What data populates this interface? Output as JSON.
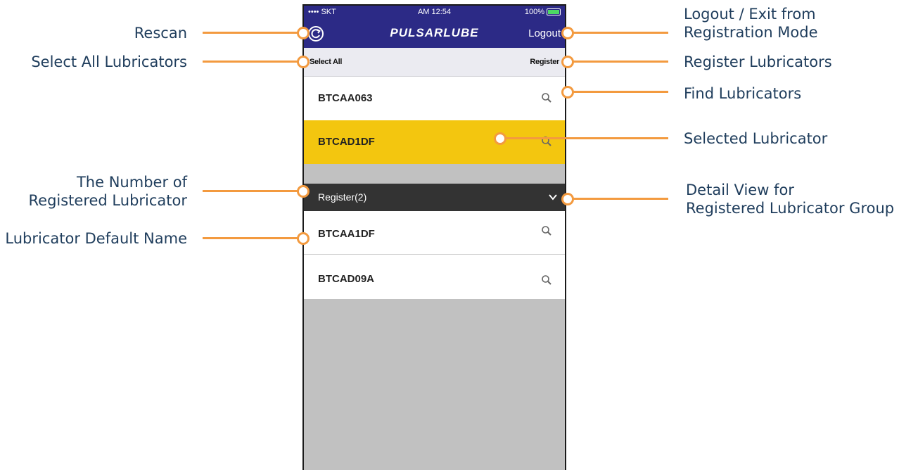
{
  "status_bar": {
    "carrier": "•••• SKT",
    "time": "AM 12:54",
    "battery": "100%"
  },
  "nav": {
    "brand": "PULSARLUBE",
    "logout_label": "Logout"
  },
  "action_bar": {
    "select_all_label": "Select All",
    "register_label": "Register"
  },
  "scanned": [
    {
      "name": "BTCAA063",
      "selected": false
    },
    {
      "name": "BTCAD1DF",
      "selected": true
    }
  ],
  "registered_group": {
    "title": "Register(2)",
    "items": [
      {
        "name": "BTCAA1DF"
      },
      {
        "name": "BTCAD09A"
      }
    ]
  },
  "annotations": {
    "rescan": "Rescan",
    "select_all": "Select All Lubricators",
    "number_registered": [
      "The Number of",
      "Registered Lubricator"
    ],
    "default_name": "Lubricator Default Name",
    "logout": [
      "Logout / Exit from",
      "Registration Mode"
    ],
    "register": "Register Lubricators",
    "find": "Find Lubricators",
    "selected": "Selected Lubricator",
    "detail_view": [
      "Detail View for",
      "Registered Lubricator Group"
    ]
  },
  "colors": {
    "brand": "#2c2a86",
    "selected_row": "#f3c60f",
    "group_header": "#333333",
    "callout": "#f39a3f",
    "annotation_text": "#1f3d5c"
  }
}
